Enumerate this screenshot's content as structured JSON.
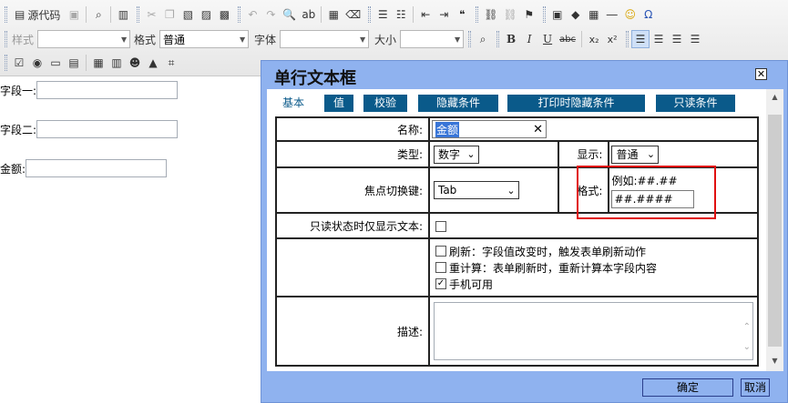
{
  "toolbar": {
    "row1": {
      "source_label": "源代码"
    },
    "row2": {
      "style_label": "样式",
      "format_label": "格式",
      "format_value": "普通",
      "font_label": "字体",
      "size_label": "大小",
      "bold": "B",
      "italic": "I",
      "underline": "U",
      "strike": "abc",
      "subscript": "x₂",
      "superscript": "x²",
      "omega": "Ω"
    }
  },
  "form": {
    "field1_label": "字段一:",
    "field2_label": "字段二:",
    "amount_label": "金额:"
  },
  "dialog": {
    "title": "单行文本框",
    "close": "✕",
    "tabs": [
      "基本",
      "值",
      "校验",
      "隐藏条件",
      "打印时隐藏条件",
      "只读条件"
    ],
    "name_label": "名称:",
    "name_value": "金额",
    "name_clear": "✕",
    "type_label": "类型:",
    "type_value": "数字",
    "display_label": "显示:",
    "display_value": "普通",
    "focus_label": "焦点切换键:",
    "focus_value": "Tab",
    "format_label": "格式:",
    "format_example": "例如:##.##",
    "format_value": "##.####",
    "readonly_text_label": "只读状态时仅显示文本:",
    "options": [
      {
        "text": "刷新：字段值改变时，触发表单刷新动作",
        "checked": false
      },
      {
        "text": "重计算：表单刷新时，重新计算本字段内容",
        "checked": false
      },
      {
        "text": "手机可用",
        "checked": true
      }
    ],
    "description_label": "描述:",
    "ok_button": "确定",
    "cancel_button": "取消"
  },
  "colors": {
    "dialog_bg": "#8fb2ef",
    "tab_bg": "#0a5a8a",
    "highlight": "#e01010"
  }
}
